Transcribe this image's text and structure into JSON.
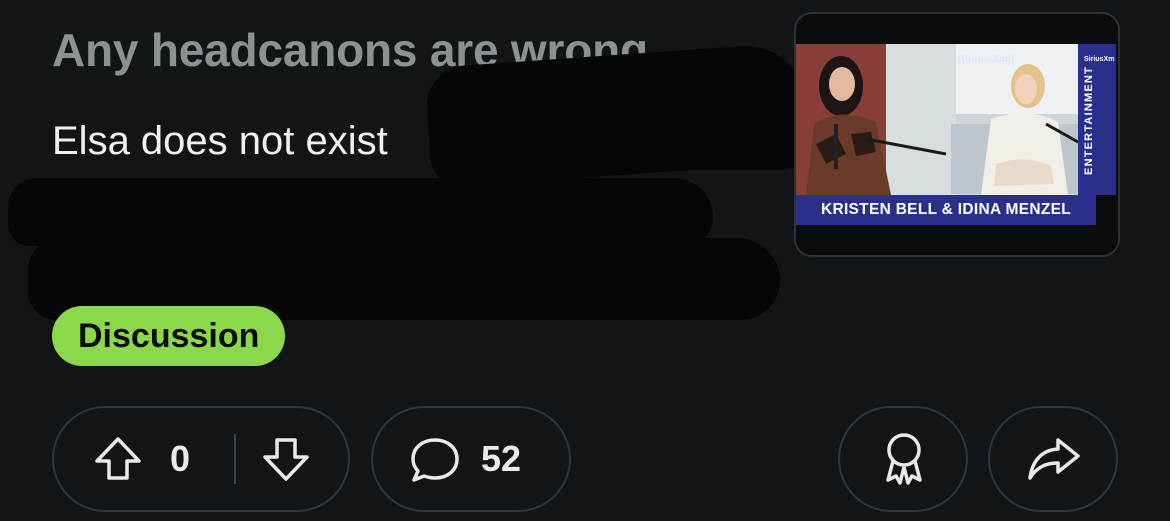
{
  "post": {
    "title": "Any headcanons are wrong",
    "body": "Elsa does not exist",
    "flair": "Discussion",
    "flair_color": "#8bd94a"
  },
  "thumbnail": {
    "caption": "KRISTEN BELL & IDINA MENZEL",
    "side_label": "ENTERTAINMENT",
    "logo": "((SiriusXm))",
    "logo_small": "SiriusXm"
  },
  "actions": {
    "vote_count": "0",
    "comment_count": "52",
    "icons": {
      "upvote": "arrow-up-icon",
      "downvote": "arrow-down-icon",
      "comment": "speech-bubble-icon",
      "award": "award-icon",
      "share": "share-arrow-icon"
    }
  },
  "colors": {
    "background": "#121517",
    "title_text": "#8c9194",
    "border": "#2f3539",
    "caption_bar": "#2a2f8c"
  }
}
